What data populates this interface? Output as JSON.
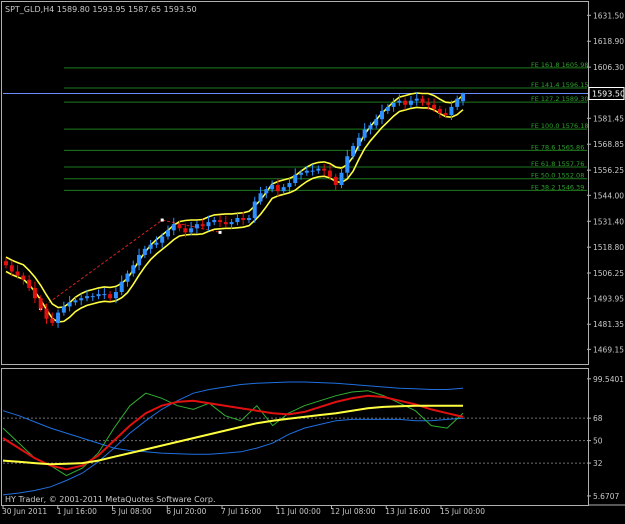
{
  "symbol_header": "SPT_GLD,H4  1589.80 1593.95 1587.65 1593.50",
  "footer_text": "HY Trader, © 2001-2011 MetaQuotes Software Corp.",
  "colors": {
    "background": "#000000",
    "frame": "#b0b0b0",
    "text": "#c8c8c8",
    "candle_up": "#2e8fff",
    "candle_down": "#e01010",
    "envelope": "#ffff40",
    "fib_line": "#1e7a1e",
    "fib_text": "#2ea02e",
    "price_line": "#6a8cff",
    "zigzag": "#d02020",
    "osc_blue": "#2070e0",
    "osc_green": "#30b030",
    "osc_red": "#e01010",
    "osc_yellow": "#ffff40"
  },
  "chart_data": [
    {
      "type": "candlestick",
      "symbol": "SPT_GLD",
      "timeframe": "H4",
      "ylim": [
        1463,
        1637
      ],
      "y_ticks": [
        "1631.50",
        "1618.90",
        "1606.30",
        "1593.50",
        "1581.45",
        "1568.85",
        "1556.25",
        "1544.00",
        "1531.40",
        "1518.80",
        "1506.25",
        "1493.95",
        "1481.35",
        "1469.15"
      ],
      "current_price_label": "1593.50",
      "last_bar": {
        "open": 1589.8,
        "high": 1593.95,
        "low": 1587.65,
        "close": 1593.5
      },
      "x_labels": [
        "30 Jun 2011",
        "1 Jul 16:00",
        "5 Jul 08:00",
        "6 Jul 20:00",
        "7 Jul 16:00",
        "11 Jul 00:00",
        "12 Jul 08:00",
        "13 Jul 16:00",
        "15 Jul 00:00"
      ],
      "closes": [
        1510,
        1507,
        1505,
        1503,
        1499,
        1494,
        1489,
        1484,
        1482,
        1487,
        1490,
        1492,
        1493,
        1494,
        1495,
        1495,
        1496,
        1496,
        1494,
        1497,
        1502,
        1506,
        1510,
        1515,
        1518,
        1520,
        1521,
        1524,
        1527,
        1530,
        1528,
        1526,
        1528,
        1530,
        1529,
        1531,
        1532,
        1531,
        1530,
        1531,
        1533,
        1532,
        1533,
        1541,
        1545,
        1547,
        1549,
        1546,
        1548,
        1550,
        1554,
        1555,
        1556,
        1556,
        1557,
        1556,
        1553,
        1549,
        1555,
        1563,
        1568,
        1572,
        1576,
        1578,
        1581,
        1585,
        1587,
        1589,
        1590,
        1588,
        1590,
        1591,
        1589,
        1588,
        1586,
        1584,
        1583,
        1587,
        1591,
        1593.5
      ],
      "fibonacci_levels": [
        {
          "label": "FE 161.8  1605.98",
          "value": 1605.98
        },
        {
          "label": "FE 141.4  1596.15",
          "value": 1596.15
        },
        {
          "label": "FE 127.2  1589.30",
          "value": 1589.3
        },
        {
          "label": "FE 100.0  1576.18",
          "value": 1576.18
        },
        {
          "label": "FE 78.6  1565.86",
          "value": 1565.86
        },
        {
          "label": "FE 61.8  1557.76",
          "value": 1557.76
        },
        {
          "label": "FE 50.0  1552.08",
          "value": 1552.08
        },
        {
          "label": "FE 38.2  1546.39",
          "value": 1546.39
        }
      ],
      "zigzag": [
        {
          "bar": 6,
          "value": 1489
        },
        {
          "bar": 27,
          "value": 1532
        },
        {
          "bar": 37,
          "value": 1526
        }
      ]
    },
    {
      "type": "line",
      "panel": "oscillator",
      "ylim": [
        0,
        105
      ],
      "y_ticks": [
        "99.5401",
        "68",
        "50",
        "32",
        "5.6707"
      ],
      "levels": [
        68,
        50,
        32
      ],
      "series": [
        {
          "color": "#2070e0",
          "values": [
            6.5,
            8,
            10,
            13,
            18,
            24,
            33,
            44,
            56,
            66,
            75,
            82,
            88,
            91,
            93,
            95,
            96,
            96.5,
            97,
            97,
            96.5,
            96,
            95,
            94,
            93,
            92,
            91.5,
            91,
            91,
            92
          ]
        },
        {
          "color": "#2070e0",
          "values": [
            74,
            70,
            65,
            60,
            56,
            52,
            48,
            44,
            42,
            41,
            40,
            39.5,
            39,
            39,
            40,
            41,
            44,
            48,
            55,
            60,
            63,
            66,
            67,
            67,
            67,
            67,
            66,
            66,
            67,
            68
          ]
        },
        {
          "color": "#30b030",
          "values": [
            60,
            48,
            36,
            30,
            22,
            28,
            40,
            60,
            78,
            88,
            84,
            78,
            75,
            80,
            70,
            66,
            78,
            62,
            72,
            78,
            82,
            86,
            89,
            90,
            86,
            80,
            74,
            62,
            60,
            72
          ]
        },
        {
          "color": "#e01010",
          "values": [
            52,
            44,
            36,
            30,
            27,
            30,
            38,
            50,
            62,
            72,
            78,
            81,
            82,
            80,
            78,
            76,
            74,
            72,
            71,
            73,
            77,
            81,
            84,
            86,
            85,
            82,
            79,
            75,
            72,
            69
          ]
        },
        {
          "color": "#ffff40",
          "values": [
            34,
            33,
            32,
            31,
            31.5,
            32,
            34,
            37,
            40,
            43,
            46,
            49,
            52,
            55,
            58,
            61,
            64,
            66,
            67.5,
            69,
            70.5,
            72,
            74,
            76,
            77,
            77.5,
            78,
            78,
            78,
            78
          ]
        }
      ]
    }
  ]
}
